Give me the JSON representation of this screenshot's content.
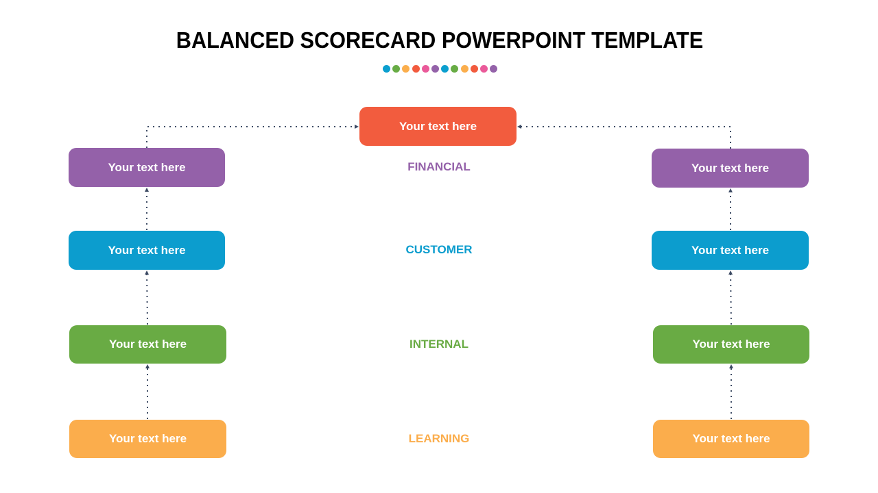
{
  "title": "BALANCED SCORECARD POWERPOINT TEMPLATE",
  "dot_colors": [
    "#0b9fcf",
    "#68ac45",
    "#fbae4d",
    "#f25b3e",
    "#ea5a9a",
    "#9462a9",
    "#0b9fcf",
    "#68ac45",
    "#fbae4d",
    "#f25b3e",
    "#ea5a9a",
    "#9462a9"
  ],
  "colors": {
    "top": "#f25c3e",
    "financial": "#9461a9",
    "customer": "#0c9dce",
    "internal": "#69ab44",
    "learning": "#fbad4c",
    "connector": "#3c4a63"
  },
  "top_box": {
    "text": "Your text here"
  },
  "levels": [
    {
      "key": "financial",
      "label": "FINANCIAL",
      "left_text": "Your text here",
      "right_text": "Your text here"
    },
    {
      "key": "customer",
      "label": "CUSTOMER",
      "left_text": "Your text here",
      "right_text": "Your text here"
    },
    {
      "key": "internal",
      "label": "INTERNAL",
      "left_text": "Your text here",
      "right_text": "Your text here"
    },
    {
      "key": "learning",
      "label": "LEARNING",
      "left_text": "Your text here",
      "right_text": "Your text here"
    }
  ]
}
